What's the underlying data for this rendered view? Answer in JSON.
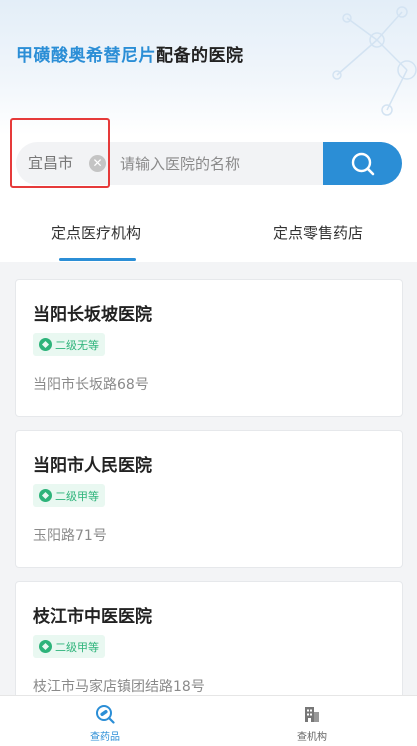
{
  "header": {
    "title_drug": "甲磺酸奥希替尼片",
    "title_rest": "配备的医院"
  },
  "search": {
    "city": "宜昌市",
    "placeholder": "请输入医院的名称",
    "value": ""
  },
  "tabs": [
    {
      "label": "定点医疗机构",
      "active": true
    },
    {
      "label": "定点零售药店",
      "active": false
    }
  ],
  "hospitals": [
    {
      "name": "当阳长坂坡医院",
      "level": "二级无等",
      "address": "当阳市长坂路68号"
    },
    {
      "name": "当阳市人民医院",
      "level": "二级甲等",
      "address": "玉阳路71号"
    },
    {
      "name": "枝江市中医医院",
      "level": "二级甲等",
      "address": "枝江市马家店镇团结路18号"
    }
  ],
  "bottom_nav": [
    {
      "label": "查药品",
      "icon": "drug-search-icon",
      "active": true
    },
    {
      "label": "查机构",
      "icon": "building-icon",
      "active": false
    }
  ],
  "colors": {
    "accent": "#2b8ed6",
    "badge_green": "#2db37a",
    "highlight_red": "#e63a3a"
  }
}
